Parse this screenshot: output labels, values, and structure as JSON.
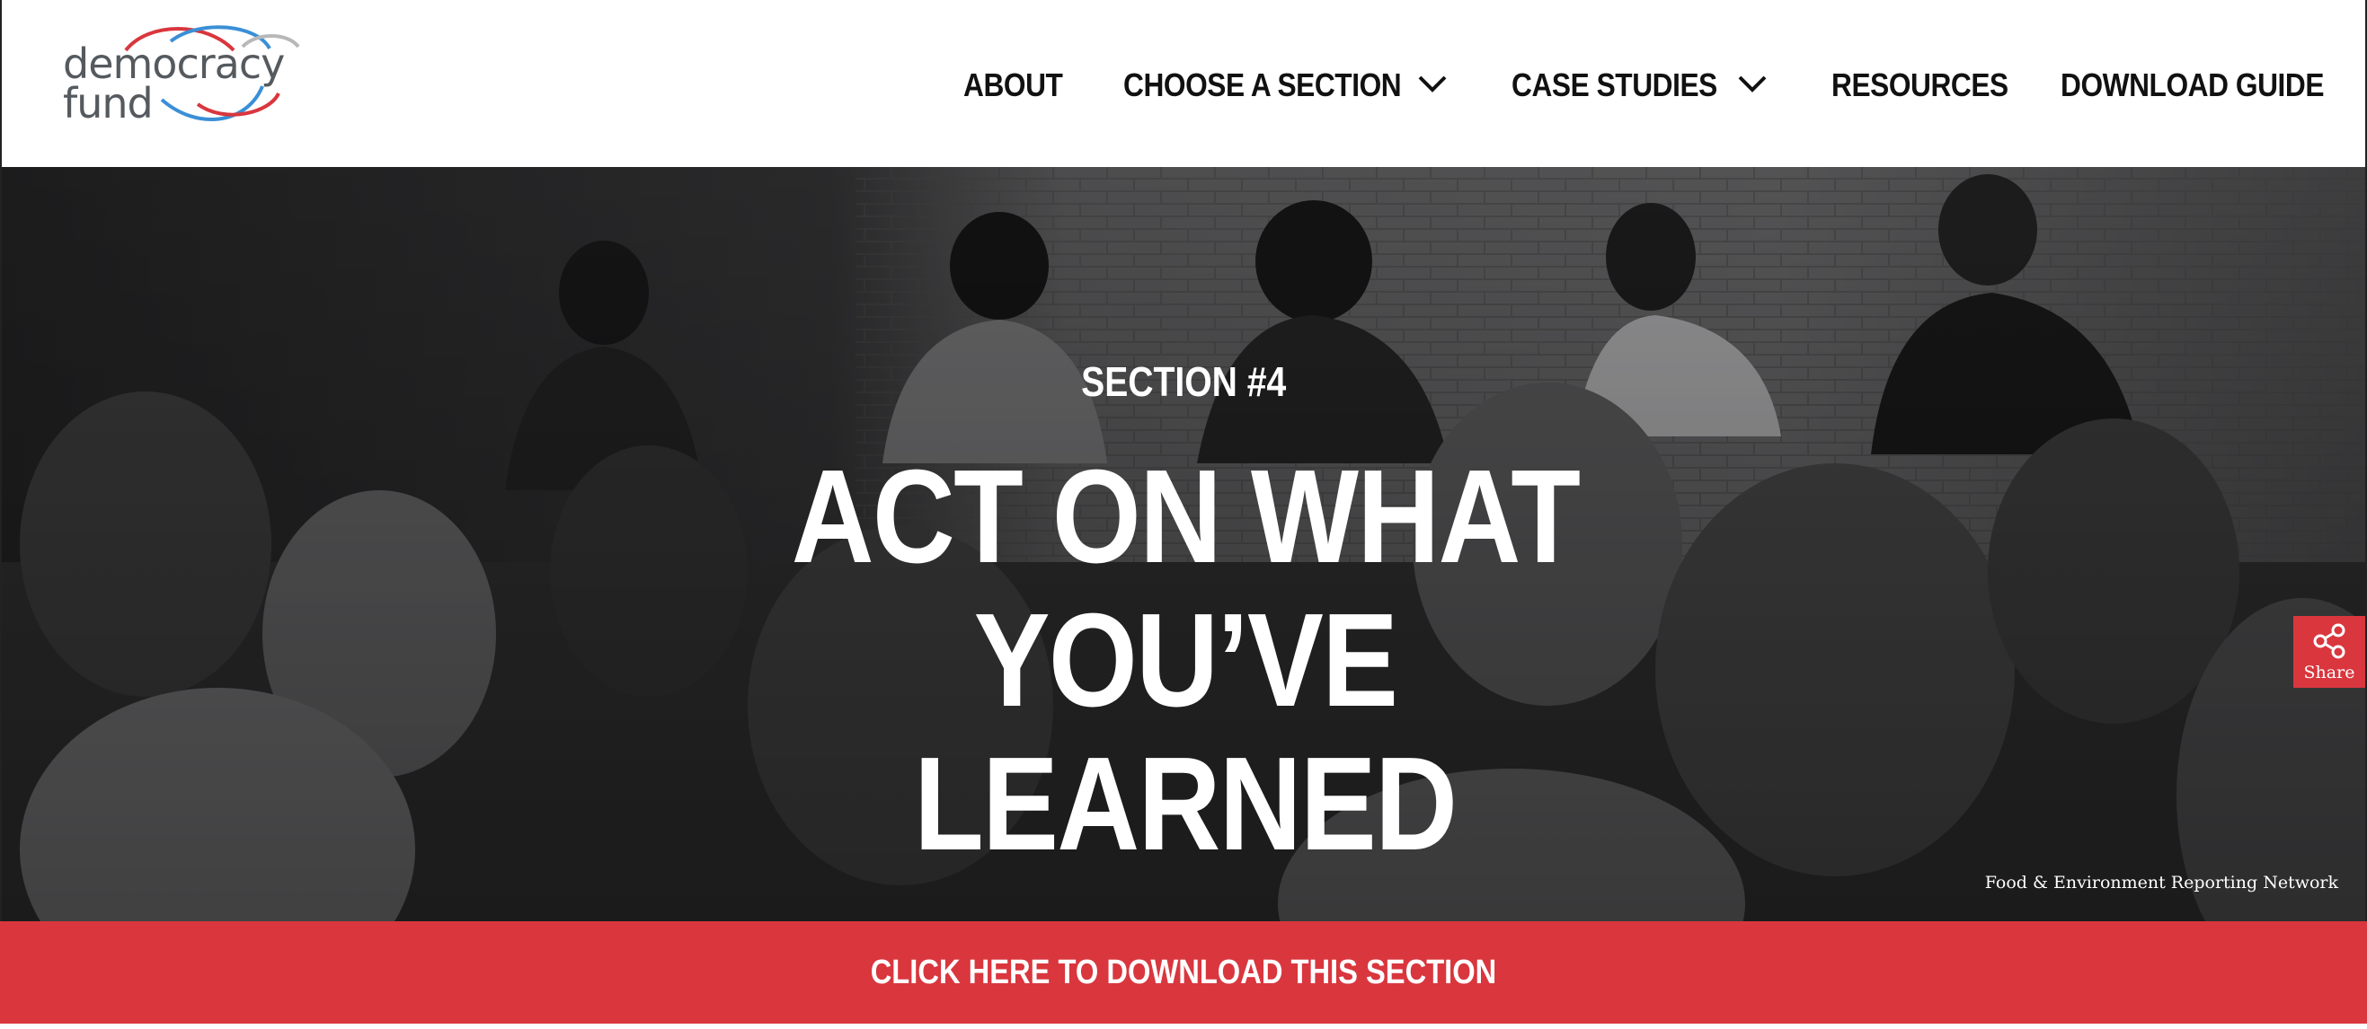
{
  "brand": {
    "logo_line1": "democracy",
    "logo_line2": "fund",
    "accent_red": "#d9363e",
    "accent_blue": "#3a8fd6",
    "logo_text_color": "#555a5f"
  },
  "nav": {
    "items": [
      {
        "label": "ABOUT",
        "has_dropdown": false
      },
      {
        "label": "CHOOSE A SECTION",
        "has_dropdown": true
      },
      {
        "label": "CASE STUDIES",
        "has_dropdown": true
      },
      {
        "label": "RESOURCES",
        "has_dropdown": false
      },
      {
        "label": "DOWNLOAD GUIDE",
        "has_dropdown": false
      }
    ],
    "dropdown_icon": "chevron-down-icon"
  },
  "hero": {
    "section_label": "SECTION #4",
    "title_line1": "ACT ON WHAT YOU’VE",
    "title_line2": "LEARNED",
    "photo_credit": "Food & Environment Reporting Network",
    "share_label": "Share",
    "share_icon": "share-icon"
  },
  "download_bar": {
    "label": "CLICK HERE TO DOWNLOAD THIS SECTION"
  }
}
